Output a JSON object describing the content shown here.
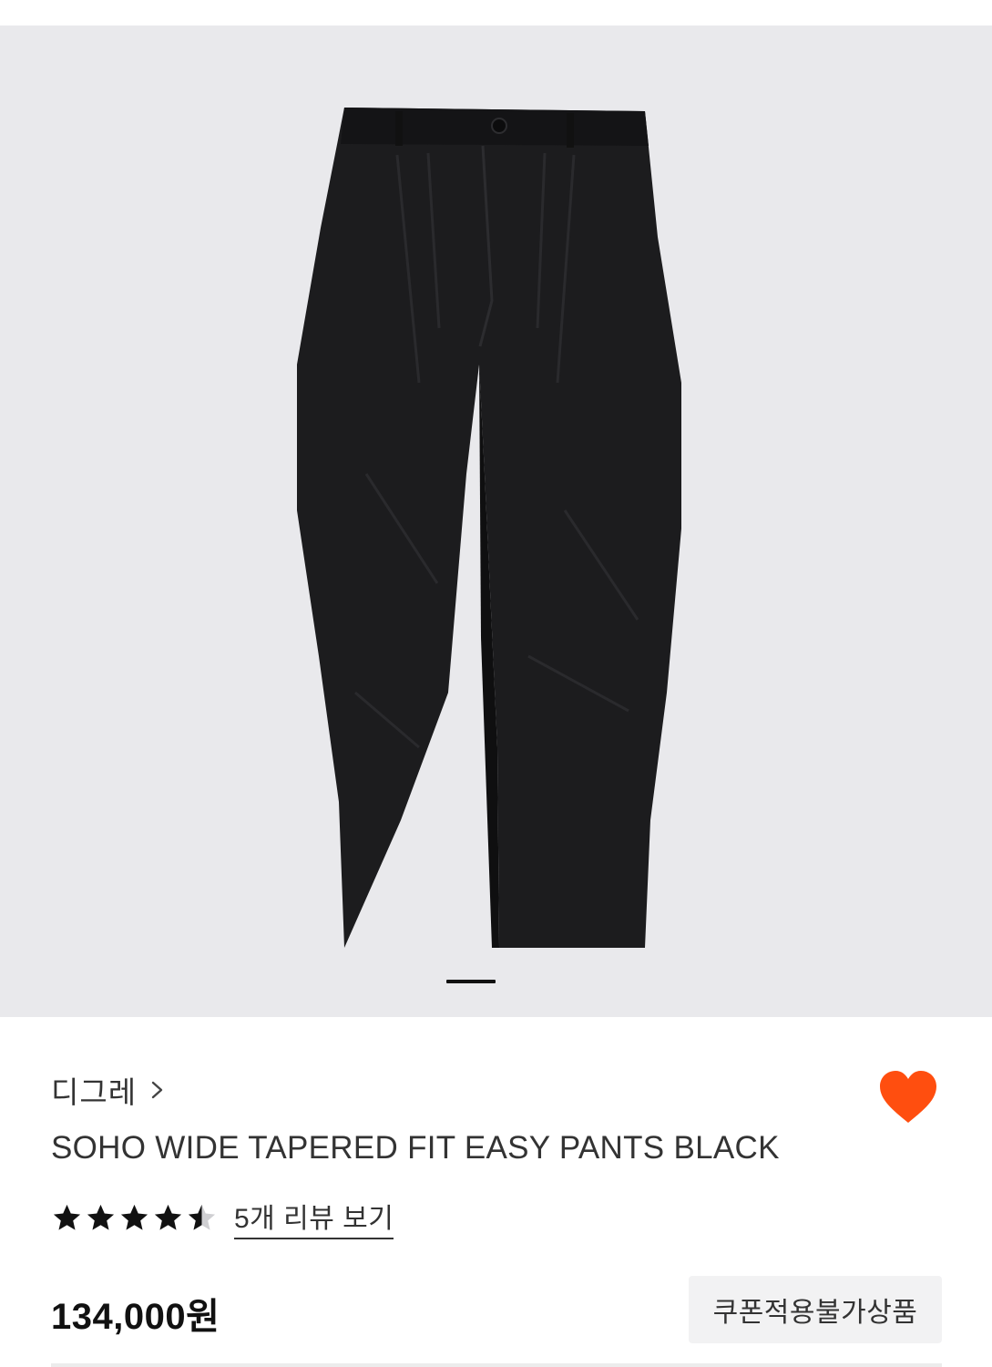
{
  "product": {
    "brand": "디그레",
    "title": "SOHO WIDE TAPERED FIT EASY PANTS BLACK",
    "rating": 4.5,
    "rating_max": 5,
    "review_link": "5개 리뷰 보기",
    "price": "134,000원",
    "coupon_badge": "쿠폰적용불가상품",
    "wishlisted": true
  },
  "gallery": {
    "current_page": 1,
    "image_subject": "black pleated tapered pants"
  },
  "icons": {
    "brand_chevron": "chevron-right-icon",
    "wishlist": "heart-icon",
    "star": "star-icon"
  },
  "colors": {
    "heart": "#ff4e0f",
    "gallery_bg": "#e9e9ec",
    "badge_bg": "#f2f2f3",
    "text": "#333333"
  }
}
